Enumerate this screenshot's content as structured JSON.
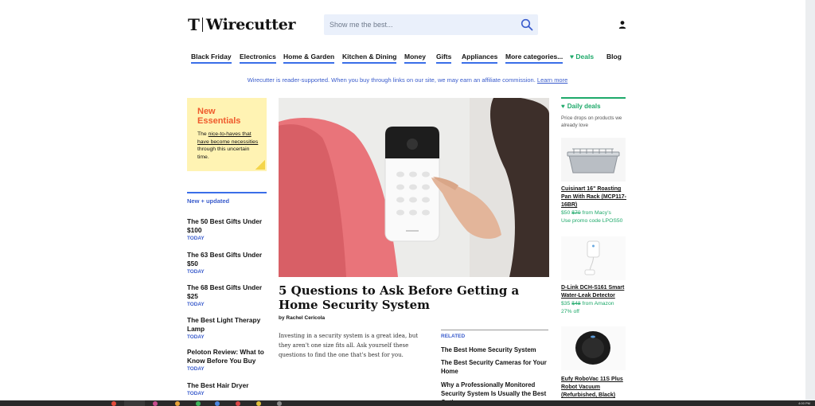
{
  "header": {
    "logo_mark": "T",
    "logo_text": "Wirecutter",
    "search_placeholder": "Show me the best...",
    "search_icon": "search-icon",
    "user_icon": "user-icon"
  },
  "nav": {
    "items": [
      {
        "label": "Black Friday"
      },
      {
        "label": "Electronics"
      },
      {
        "label": "Home & Garden"
      },
      {
        "label": "Kitchen & Dining"
      },
      {
        "label": "Money"
      },
      {
        "label": "Gifts"
      },
      {
        "label": "Appliances"
      },
      {
        "label": "More categories..."
      }
    ],
    "deals_label": "Deals",
    "blog_label": "Blog"
  },
  "affiliate": {
    "text": "Wirecutter is reader-supported. When you buy through links on our site, we may earn an affiliate commission.",
    "link": "Learn more"
  },
  "promo": {
    "title": "New Essentials",
    "body_pre": "The ",
    "body_link": "nice-to-haves that have become necessities",
    "body_post": " through this uncertain time."
  },
  "new_updated": {
    "heading": "New + updated",
    "items": [
      {
        "title": "The 50 Best Gifts Under $100",
        "date": "TODAY"
      },
      {
        "title": "The 63 Best Gifts Under $50",
        "date": "TODAY"
      },
      {
        "title": "The 68 Best Gifts Under $25",
        "date": "TODAY"
      },
      {
        "title": "The Best Light Therapy Lamp",
        "date": "TODAY"
      },
      {
        "title": "Peloton Review: What to Know Before You Buy",
        "date": "TODAY"
      },
      {
        "title": "The Best Hair Dryer",
        "date": "TODAY"
      }
    ]
  },
  "feature": {
    "headline": "5 Questions to Ask Before Getting a Home Security System",
    "byline": "by Rachel Cericola",
    "dek": "Investing in a security system is a great idea, but they aren't one size fits all. Ask yourself these questions to find the one that's best for you.",
    "related_label": "RELATED",
    "related": [
      "The Best Home Security System",
      "The Best Security Cameras for Your Home",
      "Why a Professionally Monitored Security System Is Usually the Best Option"
    ]
  },
  "daily_deals": {
    "title": "Daily deals",
    "subtitle": "Price drops on products we already love",
    "items": [
      {
        "name": "Cuisinart 16\" Roasting Pan With Rack (MCP117-16BR)",
        "price": "$50",
        "old_price": "$70",
        "source": " from Macy's",
        "extra": "Use promo code LPOS50"
      },
      {
        "name": "D-Link DCH-S161 Smart Water-Leak Detector",
        "price": "$35",
        "old_price": "$48",
        "source": " from Amazon",
        "extra": "27% off"
      },
      {
        "name": "Eufy RoboVac 11S Plus Robot Vacuum (Refurbished, Black)",
        "price": "",
        "old_price": "",
        "source": "",
        "extra": ""
      }
    ]
  },
  "taskbar": {
    "time": "4:00 PM"
  },
  "colors": {
    "accent_blue": "#3a6ee8",
    "link_blue": "#3a5ccc",
    "deal_green": "#1ea96a",
    "promo_yellow": "#fff3b3",
    "promo_orange": "#ef5a2c"
  }
}
